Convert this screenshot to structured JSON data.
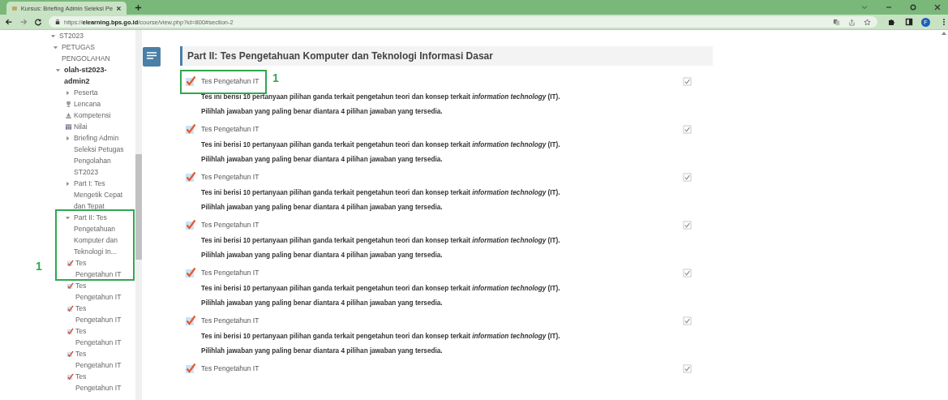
{
  "browser": {
    "tab_title": "Kursus: Briefing Admin Seleksi Pe",
    "url": "https://**elearning.bps.go.id**/course/view.php?id=800#section-2",
    "profile_initial": "F"
  },
  "sidebar": {
    "tree": [
      {
        "label": "ST2023",
        "kind": "branch",
        "expanded": true,
        "children": [
          {
            "label": "PETUGAS PENGOLAHAN",
            "kind": "branch",
            "expanded": true,
            "children": [
              {
                "label": "olah-st2023-admin2",
                "kind": "course",
                "expanded": true,
                "children": [
                  {
                    "label": "Peserta",
                    "kind": "branch",
                    "expanded": false
                  },
                  {
                    "label": "Lencana",
                    "kind": "badges"
                  },
                  {
                    "label": "Kompetensi",
                    "kind": "competencies"
                  },
                  {
                    "label": "Nilai",
                    "kind": "grades"
                  },
                  {
                    "label": "Briefing Admin Seleksi Petugas Pengolahan ST2023",
                    "kind": "branch",
                    "expanded": false
                  },
                  {
                    "label": "Part I: Tes Mengetik Cepat dan Tepat",
                    "kind": "branch",
                    "expanded": false
                  },
                  {
                    "label": "Part II: Tes Pengetahuan Komputer dan Teknologi In...",
                    "kind": "branch",
                    "expanded": true,
                    "children": [
                      {
                        "label": "Tes Pengetahun IT",
                        "kind": "quiz"
                      },
                      {
                        "label": "Tes Pengetahun IT",
                        "kind": "quiz"
                      },
                      {
                        "label": "Tes Pengetahun IT",
                        "kind": "quiz"
                      },
                      {
                        "label": "Tes Pengetahun IT",
                        "kind": "quiz"
                      },
                      {
                        "label": "Tes Pengetahun IT",
                        "kind": "quiz"
                      },
                      {
                        "label": "Tes Pengetahun IT",
                        "kind": "quiz"
                      }
                    ]
                  }
                ]
              }
            ]
          }
        ]
      }
    ]
  },
  "section": {
    "title": "Part II: Tes Pengetahuan Komputer dan Teknologi Informasi Dasar",
    "activities": [
      {
        "title": "Tes Pengetahun IT",
        "completed": true,
        "description": [
          "Tes ini berisi 10 pertanyaan pilihan ganda terkait pengetahun teori dan konsep terkait *information technology* (IT).",
          "Pilihlah jawaban yang paling benar diantara 4 pilihan jawaban yang tersedia."
        ]
      },
      {
        "title": "Tes Pengetahun IT",
        "completed": true,
        "description": [
          "Tes ini berisi 10 pertanyaan pilihan ganda terkait pengetahun teori dan konsep terkait *information technology* (IT).",
          "Pilihlah jawaban yang paling benar diantara 4 pilihan jawaban yang tersedia."
        ]
      },
      {
        "title": "Tes Pengetahun IT",
        "completed": true,
        "description": [
          "Tes ini berisi 10 pertanyaan pilihan ganda terkait pengetahun teori dan konsep terkait *information technology* (IT).",
          "Pilihlah jawaban yang paling benar diantara 4 pilihan jawaban yang tersedia."
        ]
      },
      {
        "title": "Tes Pengetahun IT",
        "completed": true,
        "description": [
          "Tes ini berisi 10 pertanyaan pilihan ganda terkait pengetahun teori dan konsep terkait *information technology* (IT).",
          "Pilihlah jawaban yang paling benar diantara 4 pilihan jawaban yang tersedia."
        ]
      },
      {
        "title": "Tes Pengetahun IT",
        "completed": true,
        "description": [
          "Tes ini berisi 10 pertanyaan pilihan ganda terkait pengetahun teori dan konsep terkait *information technology* (IT).",
          "Pilihlah jawaban yang paling benar diantara 4 pilihan jawaban yang tersedia."
        ]
      },
      {
        "title": "Tes Pengetahun IT",
        "completed": true,
        "description": [
          "Tes ini berisi 10 pertanyaan pilihan ganda terkait pengetahun teori dan konsep terkait *information technology* (IT).",
          "Pilihlah jawaban yang paling benar diantara 4 pilihan jawaban yang tersedia."
        ]
      },
      {
        "title": "Tes Pengetahun IT",
        "completed": true
      }
    ]
  },
  "annotations": [
    {
      "label": "1"
    },
    {
      "label": "1"
    }
  ]
}
